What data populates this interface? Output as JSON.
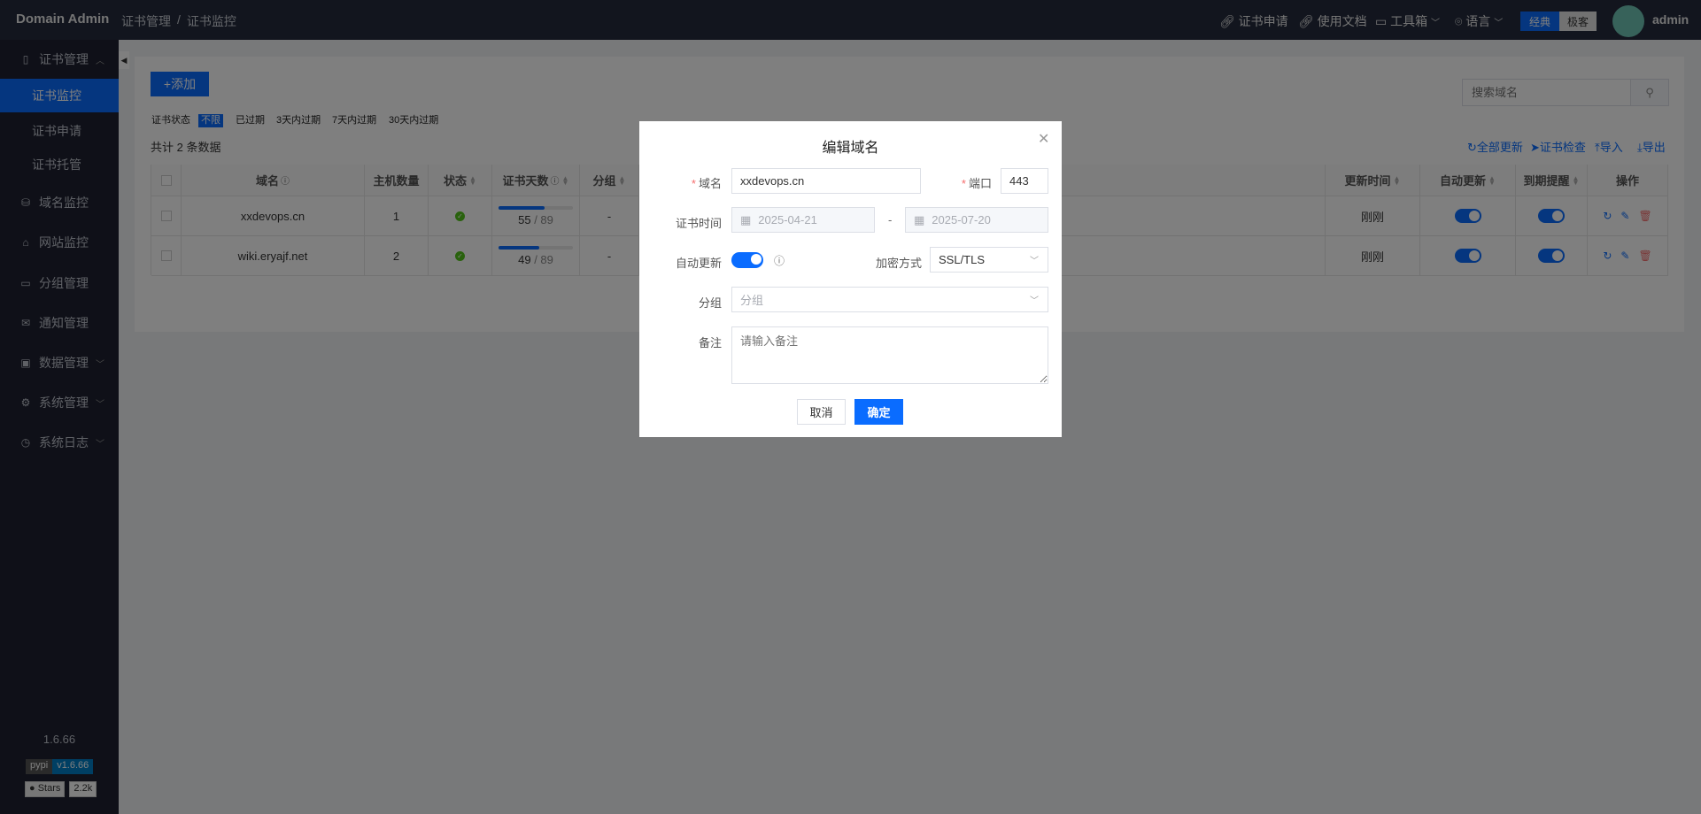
{
  "header": {
    "app_title": "Domain Admin",
    "breadcrumb": [
      "证书管理",
      "证书监控"
    ],
    "breadcrumb_sep": "/",
    "links": [
      {
        "label": "证书申请",
        "icon": "link-icon"
      },
      {
        "label": "使用文档",
        "icon": "link-icon"
      },
      {
        "label": "工具箱",
        "icon": "toolbox-icon"
      },
      {
        "label": "语言",
        "icon": "location-icon"
      }
    ],
    "theme": {
      "classic": "经典",
      "geek": "极客"
    },
    "user": "admin"
  },
  "sidebar": {
    "items": [
      {
        "label": "证书管理",
        "expanded": true
      },
      {
        "label": "证书监控",
        "active": true
      },
      {
        "label": "证书申请"
      },
      {
        "label": "证书托管"
      },
      {
        "label": "域名监控"
      },
      {
        "label": "网站监控"
      },
      {
        "label": "分组管理"
      },
      {
        "label": "通知管理"
      },
      {
        "label": "数据管理"
      },
      {
        "label": "系统管理"
      },
      {
        "label": "系统日志"
      }
    ],
    "version": "1.6.66",
    "pypi_label": "pypi",
    "pypi_version": "v1.6.66",
    "stars_label": "Stars",
    "stars_count": "2.2k"
  },
  "toolbar": {
    "add": "+添加",
    "search_placeholder": "搜索域名",
    "filter_label": "证书状态",
    "filters": [
      "不限",
      "已过期",
      "3天内过期",
      "7天内过期",
      "30天内过期"
    ],
    "total": "共计 2 条数据",
    "actions": [
      "全部更新",
      "证书检查",
      "导入",
      "导出"
    ]
  },
  "table": {
    "headers": [
      "域名",
      "主机数量",
      "状态",
      "证书天数",
      "分组",
      "更新时间",
      "自动更新",
      "到期提醒",
      "操作"
    ],
    "rows": [
      {
        "domain": "xxdevops.cn",
        "hosts": "1",
        "days_left": "55",
        "days_total": "89",
        "progress": 0.62,
        "group": "-",
        "updated": "刚刚"
      },
      {
        "domain": "wiki.eryajf.net",
        "hosts": "2",
        "days_left": "49",
        "days_total": "89",
        "progress": 0.55,
        "group": "-",
        "updated": "刚刚"
      }
    ]
  },
  "modal": {
    "title": "编辑域名",
    "domain_label": "域名",
    "domain_value": "xxdevops.cn",
    "port_label": "端口",
    "port_value": "443",
    "cert_time_label": "证书时间",
    "start_date": "2025-04-21",
    "end_date": "2025-07-20",
    "date_sep": "-",
    "auto_update_label": "自动更新",
    "encrypt_label": "加密方式",
    "encrypt_value": "SSL/TLS",
    "group_label": "分组",
    "group_placeholder": "分组",
    "note_label": "备注",
    "note_placeholder": "请输入备注",
    "cancel": "取消",
    "confirm": "确定"
  },
  "colors": {
    "primary": "#0a6cff",
    "success": "#52c41a",
    "danger": "#f56c6c"
  }
}
